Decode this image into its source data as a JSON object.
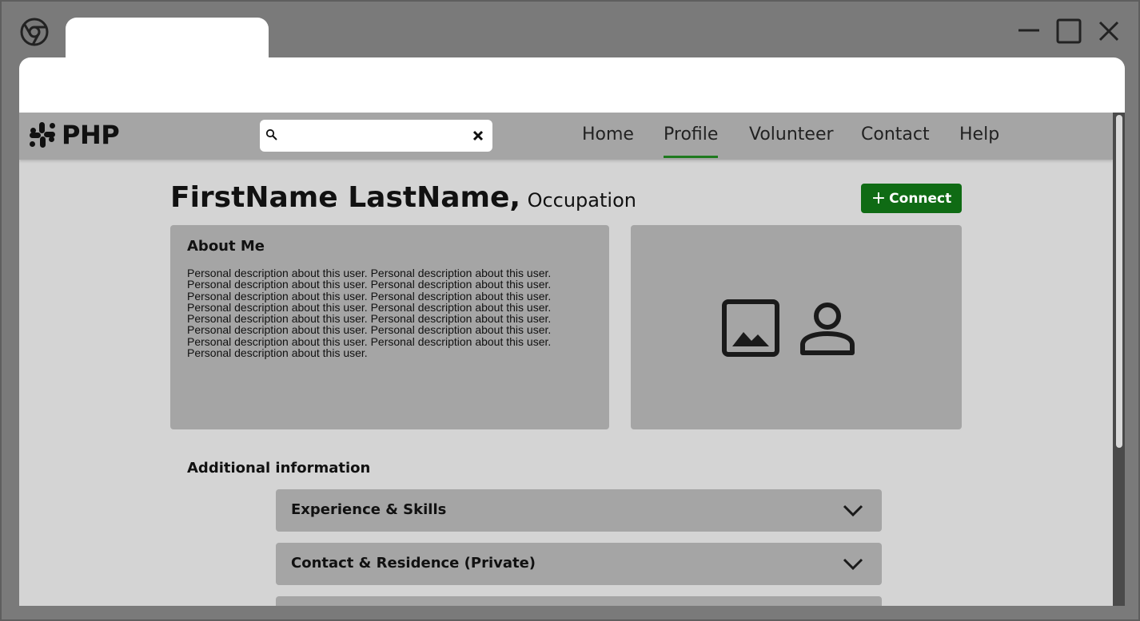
{
  "browser": {
    "tab_title": "",
    "address": ""
  },
  "nav": {
    "logo_text": "PHP",
    "search_placeholder": "",
    "links": [
      "Home",
      "Profile",
      "Volunteer",
      "Contact",
      "Help"
    ],
    "active": "Profile",
    "active_color": "#1f7a1f"
  },
  "profile": {
    "name": "FirstName LastName,",
    "occupation": "Occupation",
    "connect_label": "Connect",
    "connect_color": "#0f6b14"
  },
  "about": {
    "title": "About Me",
    "text": "Personal description about this user. Personal description about this user. Personal description about this user. Personal description about this user. Personal description about this user. Personal description about this user. Personal description about this user. Personal description about this user. Personal description about this user. Personal description about this user. Personal description about this user. Personal description about this user. Personal description about this user. Personal description about this user. Personal description about this user."
  },
  "media": {
    "icons": [
      "image-icon",
      "person-icon"
    ]
  },
  "additional": {
    "heading": "Additional information",
    "sections": [
      "Experience & Skills",
      "Contact & Residence (Private)",
      ""
    ]
  }
}
